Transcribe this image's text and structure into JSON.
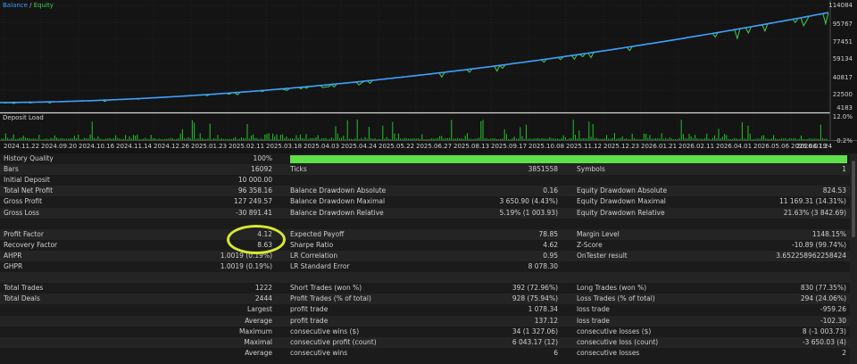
{
  "chart": {
    "legend_balance": "Balance",
    "legend_sep": " / ",
    "legend_equity": "Equity",
    "deposit_load_label": "Deposit Load",
    "colors": {
      "balance": "#3ea0ff",
      "equity": "#3ed14a",
      "load": "#22c42a",
      "bg": "#141414",
      "grid": "#2a2a2a"
    },
    "y_ticks_balance": [
      "114084",
      "95767",
      "77451",
      "59134",
      "40817",
      "22500",
      "4183"
    ],
    "y_ticks_load": [
      "12.0%",
      "0.2%"
    ],
    "x_ticks": [
      "2024.11.22",
      "2024.09.20",
      "2024.10.16",
      "2024.11.14",
      "2024.12.26",
      "2025.01.23",
      "2025.02.11",
      "2025.03.18",
      "2025.04.03",
      "2025.04.24",
      "2025.05.22",
      "2025.06.27",
      "2025.08.13",
      "2025.09.17",
      "2025.10.08",
      "2025.11.12",
      "2025.12.23",
      "2026.01.21",
      "2026.02.11",
      "2026.04.01",
      "2026.05.06",
      "2026.06.19",
      "2026.07.24"
    ]
  },
  "chart_data": {
    "type": "line",
    "series": [
      {
        "name": "Balance",
        "start": 10000,
        "end": 106358
      },
      {
        "name": "Equity",
        "start": 10000,
        "end": 106358
      }
    ],
    "ylim": [
      4183,
      114084
    ],
    "load_ylim": [
      0.2,
      12.0
    ],
    "grid": true
  },
  "stats": {
    "history_quality": {
      "label": "History Quality",
      "value": "100%",
      "fraction": 1.0
    },
    "bars": {
      "label": "Bars",
      "value": "16092"
    },
    "ticks": {
      "label": "Ticks",
      "value": "3851558"
    },
    "symbols": {
      "label": "Symbols",
      "value": "1"
    },
    "initial_deposit": {
      "label": "Initial Deposit",
      "value": "10 000.00"
    },
    "total_net_profit": {
      "label": "Total Net Profit",
      "value": "96 358.16"
    },
    "balance_dd_abs": {
      "label": "Balance Drawdown Absolute",
      "value": "0.16"
    },
    "equity_dd_abs": {
      "label": "Equity Drawdown Absolute",
      "value": "824.53"
    },
    "gross_profit": {
      "label": "Gross Profit",
      "value": "127 249.57"
    },
    "balance_dd_max": {
      "label": "Balance Drawdown Maximal",
      "value": "3 650.90 (4.43%)"
    },
    "equity_dd_max": {
      "label": "Equity Drawdown Maximal",
      "value": "11 169.31 (14.31%)"
    },
    "gross_loss": {
      "label": "Gross Loss",
      "value": "-30 891.41"
    },
    "balance_dd_rel": {
      "label": "Balance Drawdown Relative",
      "value": "5.19% (1 003.93)"
    },
    "equity_dd_rel": {
      "label": "Equity Drawdown Relative",
      "value": "21.63% (3 842.69)"
    },
    "profit_factor": {
      "label": "Profit Factor",
      "value": "4.12"
    },
    "expected_payoff": {
      "label": "Expected Payoff",
      "value": "78.85"
    },
    "margin_level": {
      "label": "Margin Level",
      "value": "1148.15%"
    },
    "recovery_factor": {
      "label": "Recovery Factor",
      "value": "8.63"
    },
    "sharpe_ratio": {
      "label": "Sharpe Ratio",
      "value": "4.62"
    },
    "z_score": {
      "label": "Z-Score",
      "value": "-10.89 (99.74%)"
    },
    "ahpr": {
      "label": "AHPR",
      "value": "1.0019 (0.19%)"
    },
    "lr_correlation": {
      "label": "LR Correlation",
      "value": "0.95"
    },
    "ontester": {
      "label": "OnTester result",
      "value": "3.652258962258424"
    },
    "ghpr": {
      "label": "GHPR",
      "value": "1.0019 (0.19%)"
    },
    "lr_std_error": {
      "label": "LR Standard Error",
      "value": "8 078.30"
    },
    "total_trades": {
      "label": "Total Trades",
      "value": "1222"
    },
    "short_trades": {
      "label": "Short Trades (won %)",
      "value": "392 (72.96%)"
    },
    "long_trades": {
      "label": "Long Trades (won %)",
      "value": "830 (77.35%)"
    },
    "total_deals": {
      "label": "Total Deals",
      "value": "2444"
    },
    "profit_trades": {
      "label": "Profit Trades (% of total)",
      "value": "928 (75.94%)"
    },
    "loss_trades": {
      "label": "Loss Trades (% of total)",
      "value": "294 (24.06%)"
    },
    "largest": {
      "label": "Largest",
      "profit_label": "profit trade",
      "profit_value": "1 078.34",
      "loss_label": "loss trade",
      "loss_value": "-959.26"
    },
    "average": {
      "label": "Average",
      "profit_label": "profit trade",
      "profit_value": "137.12",
      "loss_label": "loss trade",
      "loss_value": "-102.30"
    },
    "maximum": {
      "label": "Maximum",
      "profit_label": "consecutive wins ($)",
      "profit_value": "34 (1 327.06)",
      "loss_label": "consecutive losses ($)",
      "loss_value": "8 (-1 003.73)"
    },
    "maximal": {
      "label": "Maximal",
      "profit_label": "consecutive profit (count)",
      "profit_value": "6 043.17 (12)",
      "loss_label": "consecutive loss (count)",
      "loss_value": "-3 650.03 (4)"
    },
    "average_consec": {
      "label": "Average",
      "profit_label": "consecutive wins",
      "profit_value": "6",
      "loss_label": "consecutive losses",
      "loss_value": "2"
    }
  }
}
